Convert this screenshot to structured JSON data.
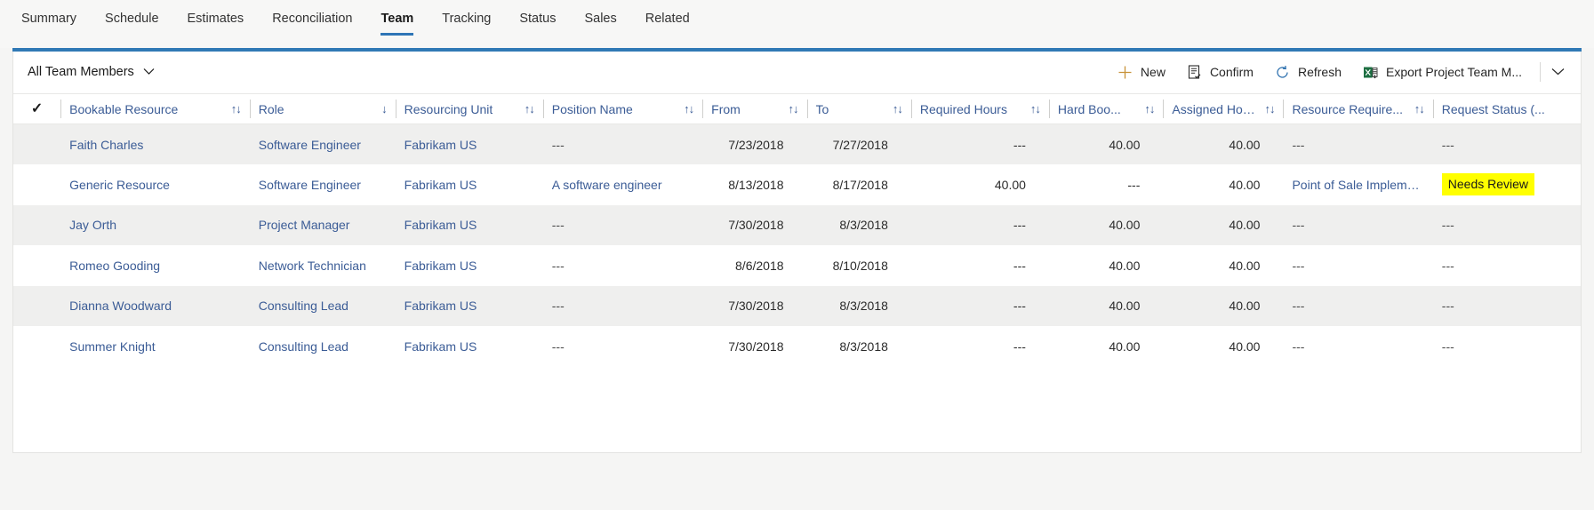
{
  "tabs": [
    {
      "label": "Summary",
      "active": false
    },
    {
      "label": "Schedule",
      "active": false
    },
    {
      "label": "Estimates",
      "active": false
    },
    {
      "label": "Reconciliation",
      "active": false
    },
    {
      "label": "Team",
      "active": true
    },
    {
      "label": "Tracking",
      "active": false
    },
    {
      "label": "Status",
      "active": false
    },
    {
      "label": "Sales",
      "active": false
    },
    {
      "label": "Related",
      "active": false
    }
  ],
  "commandbar": {
    "view_selector": {
      "label": "All Team Members",
      "chevron_icon": "chevron-down-icon"
    },
    "commands": [
      {
        "label": "New",
        "icon": "plus-icon"
      },
      {
        "label": "Confirm",
        "icon": "confirm-checklist-icon"
      },
      {
        "label": "Refresh",
        "icon": "refresh-icon"
      },
      {
        "label": "Export Project Team M...",
        "icon": "excel-export-icon"
      }
    ],
    "overflow_icon": "chevron-down-icon"
  },
  "grid": {
    "select_all_icon": "checkmark-icon",
    "columns": [
      {
        "label": "Bookable Resource",
        "sort": "unsorted",
        "align": "left"
      },
      {
        "label": "Role",
        "sort": "desc",
        "align": "left"
      },
      {
        "label": "Resourcing Unit",
        "sort": "unsorted",
        "align": "left"
      },
      {
        "label": "Position Name",
        "sort": "unsorted",
        "align": "left"
      },
      {
        "label": "From",
        "sort": "unsorted",
        "align": "left"
      },
      {
        "label": "To",
        "sort": "unsorted",
        "align": "left"
      },
      {
        "label": "Required Hours",
        "sort": "unsorted",
        "align": "left"
      },
      {
        "label": "Hard Boo...",
        "sort": "unsorted",
        "align": "left"
      },
      {
        "label": "Assigned Hours",
        "sort": "unsorted",
        "align": "left"
      },
      {
        "label": "Resource Require...",
        "sort": "unsorted",
        "align": "left"
      },
      {
        "label": "Request Status (...",
        "sort": "none",
        "align": "left"
      }
    ],
    "rows": [
      {
        "bookable_resource": "Faith Charles",
        "role": "Software Engineer",
        "resourcing_unit": "Fabrikam US",
        "position_name": "---",
        "from": "7/23/2018",
        "to": "7/27/2018",
        "required_hours": "---",
        "hard_booked_hours": "40.00",
        "assigned_hours": "40.00",
        "resource_requirement": "---",
        "request_status": "---",
        "request_status_highlighted": false
      },
      {
        "bookable_resource": "Generic Resource",
        "role": "Software Engineer",
        "resourcing_unit": "Fabrikam US",
        "position_name": "A software engineer",
        "from": "8/13/2018",
        "to": "8/17/2018",
        "required_hours": "40.00",
        "hard_booked_hours": "---",
        "assigned_hours": "40.00",
        "resource_requirement": "Point of Sale Impleme...",
        "request_status": "Needs Review",
        "request_status_highlighted": true
      },
      {
        "bookable_resource": "Jay Orth",
        "role": "Project Manager",
        "resourcing_unit": "Fabrikam US",
        "position_name": "---",
        "from": "7/30/2018",
        "to": "8/3/2018",
        "required_hours": "---",
        "hard_booked_hours": "40.00",
        "assigned_hours": "40.00",
        "resource_requirement": "---",
        "request_status": "---",
        "request_status_highlighted": false
      },
      {
        "bookable_resource": "Romeo Gooding",
        "role": "Network Technician",
        "resourcing_unit": "Fabrikam US",
        "position_name": "---",
        "from": "8/6/2018",
        "to": "8/10/2018",
        "required_hours": "---",
        "hard_booked_hours": "40.00",
        "assigned_hours": "40.00",
        "resource_requirement": "---",
        "request_status": "---",
        "request_status_highlighted": false
      },
      {
        "bookable_resource": "Dianna Woodward",
        "role": "Consulting Lead",
        "resourcing_unit": "Fabrikam US",
        "position_name": "---",
        "from": "7/30/2018",
        "to": "8/3/2018",
        "required_hours": "---",
        "hard_booked_hours": "40.00",
        "assigned_hours": "40.00",
        "resource_requirement": "---",
        "request_status": "---",
        "request_status_highlighted": false
      },
      {
        "bookable_resource": "Summer Knight",
        "role": "Consulting Lead",
        "resourcing_unit": "Fabrikam US",
        "position_name": "---",
        "from": "7/30/2018",
        "to": "8/3/2018",
        "required_hours": "---",
        "hard_booked_hours": "40.00",
        "assigned_hours": "40.00",
        "resource_requirement": "---",
        "request_status": "---",
        "request_status_highlighted": false
      }
    ]
  },
  "colors": {
    "accent_blue": "#3079b5",
    "link_blue": "#3b5c96",
    "highlight_yellow": "#ffff00",
    "row_alt": "#efefee"
  }
}
